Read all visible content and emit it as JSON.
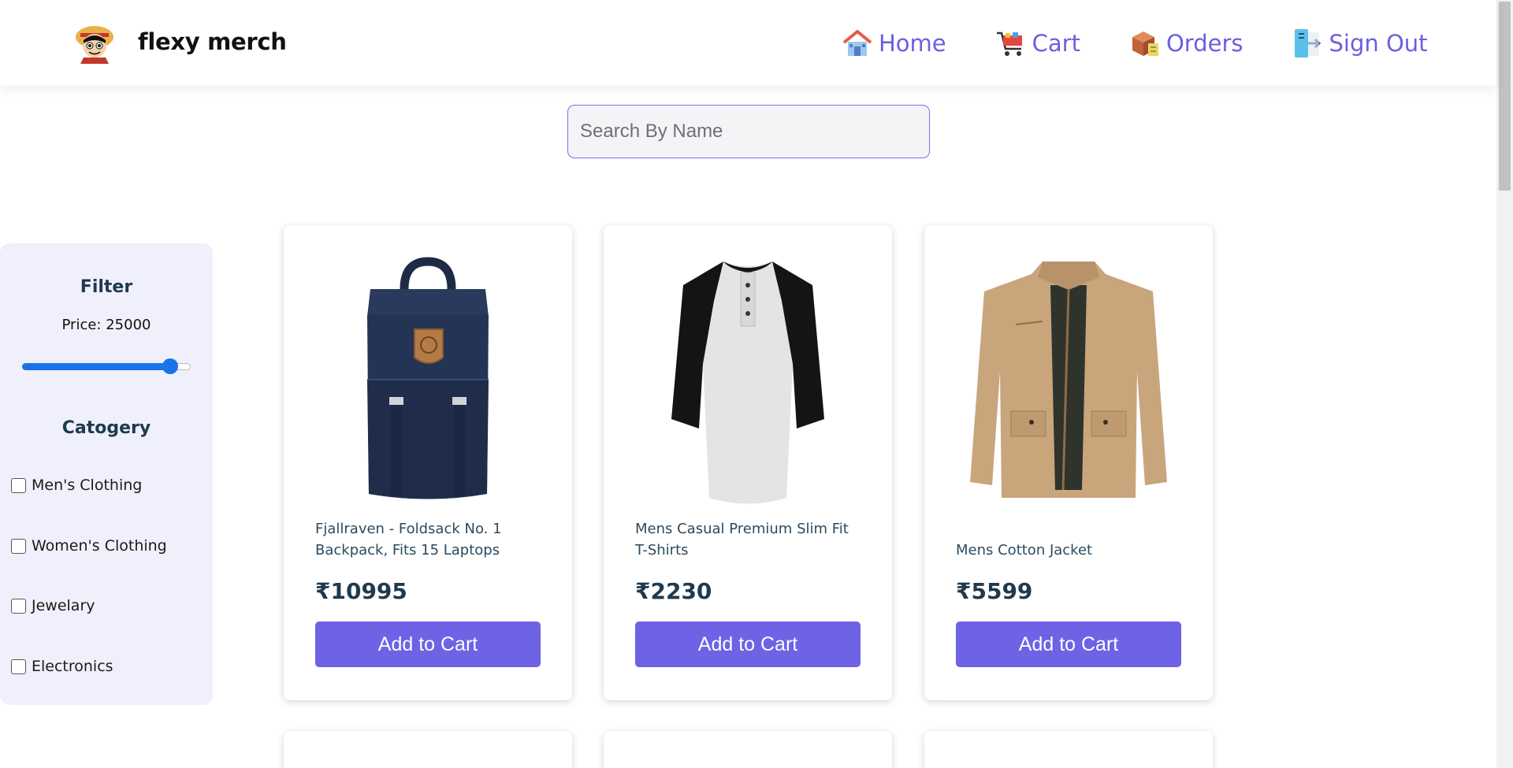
{
  "brand": {
    "name": "flexy merch",
    "logo_icon": "luffy-avatar-icon"
  },
  "nav": [
    {
      "label": "Home",
      "icon": "house-icon"
    },
    {
      "label": "Cart",
      "icon": "cart-icon"
    },
    {
      "label": "Orders",
      "icon": "package-icon"
    },
    {
      "label": "Sign Out",
      "icon": "sign-out-icon"
    }
  ],
  "search": {
    "placeholder": "Search By Name",
    "value": ""
  },
  "filter": {
    "title": "Filter",
    "price_label": "Price: 25000",
    "price_level": 0.88,
    "category_title": "Catogery",
    "categories": [
      "Men's Clothing",
      "Women's Clothing",
      "Jewelary",
      "Electronics"
    ]
  },
  "products": [
    {
      "title": "Fjallraven - Foldsack No. 1 Backpack, Fits 15 Laptops",
      "price": "₹10995",
      "button": "Add to Cart",
      "image": "backpack-image"
    },
    {
      "title": "Mens Casual Premium Slim Fit T-Shirts",
      "price": "₹2230",
      "button": "Add to Cart",
      "image": "raglan-tshirt-image"
    },
    {
      "title": "Mens Cotton Jacket",
      "price": "₹5599",
      "button": "Add to Cart",
      "image": "jacket-image"
    }
  ],
  "colors": {
    "accent": "#6e62e5",
    "nav_text": "#6b5fe0",
    "sidebar_bg": "#f0f0fc",
    "slider": "#1a73e8"
  }
}
